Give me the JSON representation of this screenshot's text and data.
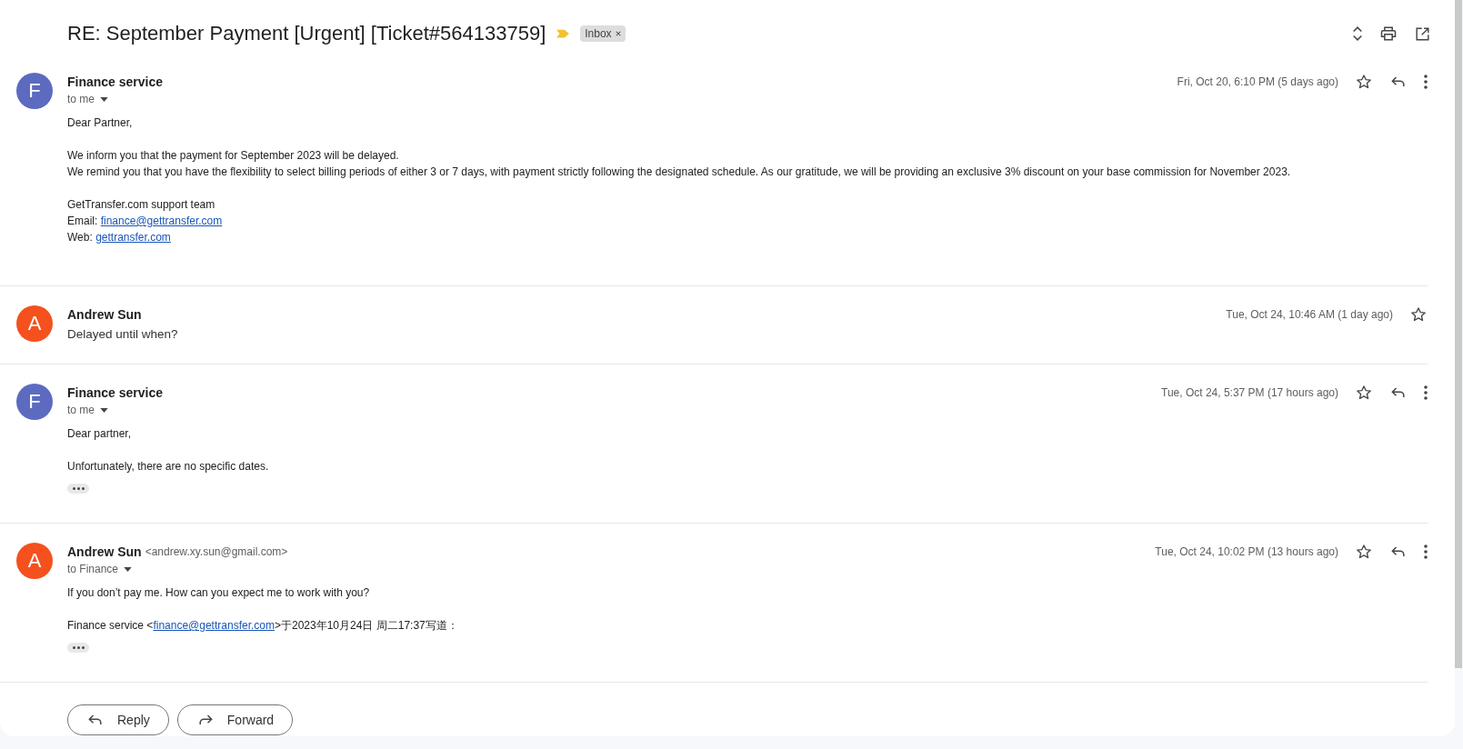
{
  "subject": "RE: September Payment [Urgent] [Ticket#564133759]",
  "important": true,
  "labels": [
    {
      "text": "Inbox"
    }
  ],
  "messages": [
    {
      "kind": "expanded",
      "avatar": "F",
      "color": "#5c6bc0",
      "sender": "Finance service",
      "date": "Fri, Oct 20, 6:10 PM (5 days ago)",
      "starred": false,
      "to": "to me",
      "paragraphs": [
        [
          {
            "text": "Dear Partner,"
          }
        ],
        [
          {
            "text": "We inform you that the payment for September 2023 will be delayed."
          },
          {
            "text": "We remind you that you have the flexibility to select billing periods of either 3 or 7 days, with payment strictly following the designated schedule. As our gratitude, we will be providing an exclusive 3% discount on your base commission for November 2023."
          }
        ],
        [
          {
            "text": "GetTransfer.com support team"
          },
          {
            "text": "Email: ",
            "link": "finance@gettransfer.com"
          },
          {
            "text": "Web: ",
            "link": "gettransfer.com"
          }
        ]
      ]
    },
    {
      "kind": "collapsed",
      "avatar": "A",
      "color": "#f4511e",
      "sender": "Andrew Sun",
      "date": "Tue, Oct 24, 10:46 AM (1 day ago)",
      "starred": false,
      "snippet": "Delayed until when?"
    },
    {
      "kind": "expanded",
      "avatar": "F",
      "color": "#5c6bc0",
      "sender": "Finance service",
      "date": "Tue, Oct 24, 5:37 PM (17 hours ago)",
      "starred": false,
      "to": "to me",
      "trimmed": true,
      "paragraphs": [
        [
          {
            "text": "Dear partner,"
          }
        ],
        [
          {
            "text": "Unfortunately, there are no specific dates."
          }
        ]
      ]
    },
    {
      "kind": "expanded",
      "avatar": "A",
      "color": "#f4511e",
      "sender": "Andrew Sun",
      "address": "<andrew.xy.sun@gmail.com>",
      "date": "Tue, Oct 24, 10:02 PM (13 hours ago)",
      "starred": false,
      "to": "to Finance",
      "trimmed": true,
      "paragraphs": [
        [
          {
            "text": "If you don’t pay me. How can you expect me to work with you?"
          }
        ],
        [
          {
            "text": "Finance service <",
            "link": "finance@gettransfer.com",
            "after": ">于2023年10月24日 周二17:37写道："
          }
        ]
      ]
    }
  ],
  "actions": [
    {
      "kind": "reply",
      "label": "Reply"
    },
    {
      "kind": "forward",
      "label": "Forward"
    }
  ]
}
